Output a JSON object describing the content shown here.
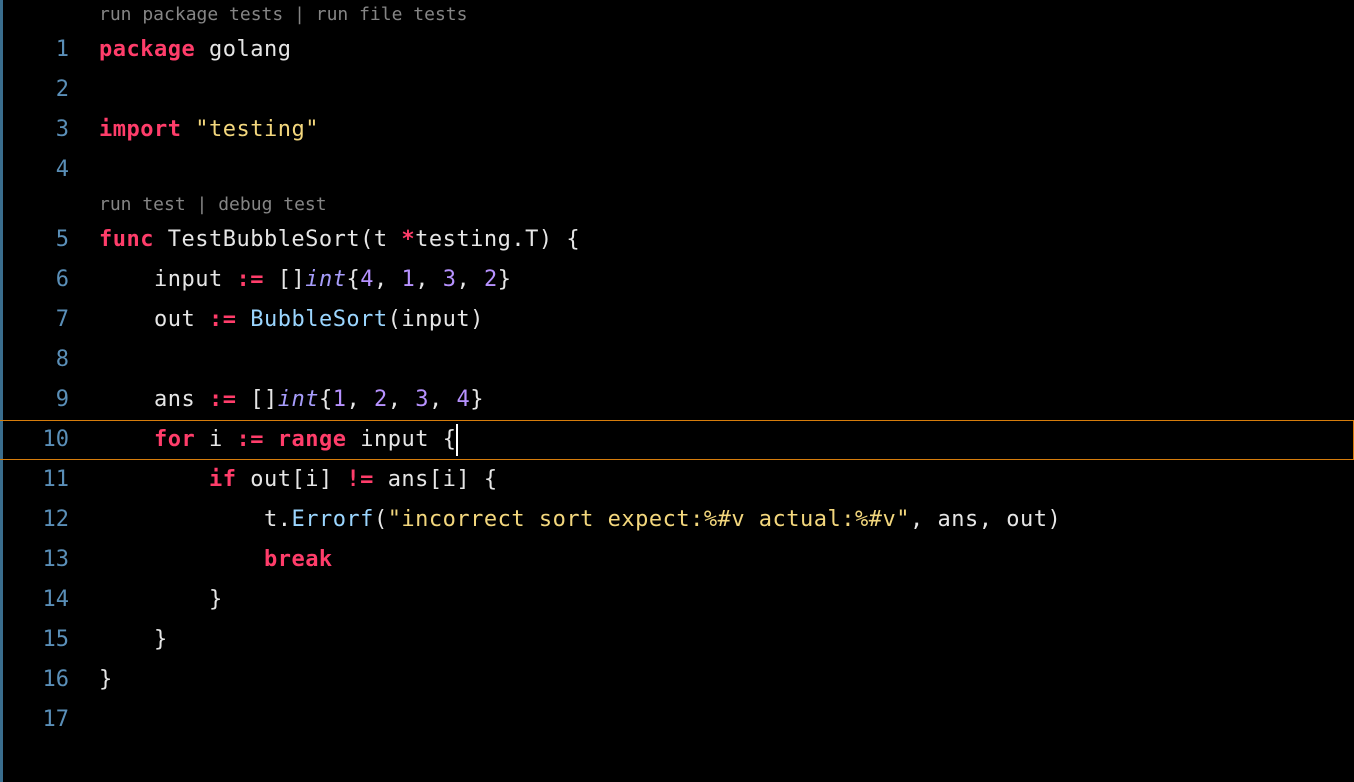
{
  "codelens": {
    "top": {
      "runPackage": "run package tests",
      "runFile": "run file tests",
      "sep": " | "
    },
    "func": {
      "runTest": "run test",
      "debugTest": "debug test",
      "sep": " | "
    }
  },
  "gutter": {
    "lines": [
      "1",
      "2",
      "3",
      "4",
      "5",
      "6",
      "7",
      "8",
      "9",
      "10",
      "11",
      "12",
      "13",
      "14",
      "15",
      "16",
      "17"
    ]
  },
  "tokens": {
    "l1": {
      "package": "package",
      "pkgName": " golang"
    },
    "l3": {
      "import": "import",
      "str": "\"testing\""
    },
    "l5": {
      "func": "func",
      "name": " TestBubbleSort",
      "paren1": "(",
      "param": "t ",
      "star": "*",
      "pkg": "testing.T",
      "paren2": ")",
      "brace": " {"
    },
    "l6": {
      "indent": "    ",
      "var": "input ",
      "assign": ":=",
      "sp": " ",
      "brk1": "[]",
      "type": "int",
      "brace1": "{",
      "n1": "4",
      "c1": ", ",
      "n2": "1",
      "c2": ", ",
      "n3": "3",
      "c3": ", ",
      "n4": "2",
      "brace2": "}"
    },
    "l7": {
      "indent": "    ",
      "var": "out ",
      "assign": ":=",
      "sp": " ",
      "call": "BubbleSort",
      "paren1": "(",
      "arg": "input",
      "paren2": ")"
    },
    "l9": {
      "indent": "    ",
      "var": "ans ",
      "assign": ":=",
      "sp": " ",
      "brk1": "[]",
      "type": "int",
      "brace1": "{",
      "n1": "1",
      "c1": ", ",
      "n2": "2",
      "c2": ", ",
      "n3": "3",
      "c3": ", ",
      "n4": "4",
      "brace2": "}"
    },
    "l10": {
      "indent": "    ",
      "for": "for",
      "sp1": " ",
      "var": "i ",
      "assign": ":=",
      "sp2": " ",
      "range": "range",
      "sp3": " ",
      "iter": "input ",
      "brace": "{"
    },
    "l11": {
      "indent": "        ",
      "if": "if",
      "sp1": " ",
      "lhs": "out[i] ",
      "neq": "!=",
      "sp2": " ",
      "rhs": "ans[i] ",
      "brace": "{"
    },
    "l12": {
      "indent": "            ",
      "obj": "t.",
      "method": "Errorf",
      "paren1": "(",
      "str": "\"incorrect sort expect:%#v actual:%#v\"",
      "args": ", ans, out",
      "paren2": ")"
    },
    "l13": {
      "indent": "            ",
      "break": "break"
    },
    "l14": {
      "indent": "        ",
      "brace": "}"
    },
    "l15": {
      "indent": "    ",
      "brace": "}"
    },
    "l16": {
      "brace": "}"
    }
  },
  "currentLine": 10
}
